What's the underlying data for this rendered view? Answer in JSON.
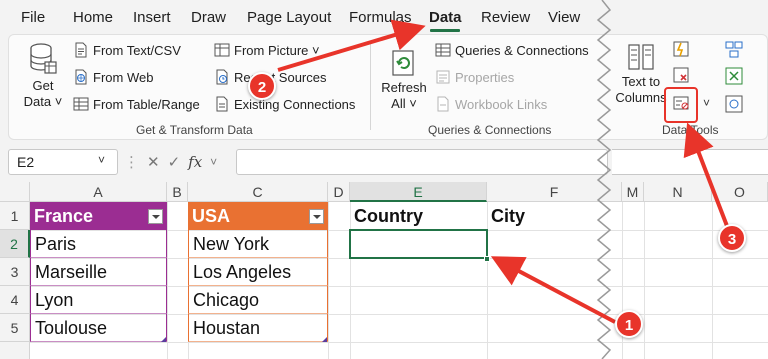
{
  "menu": {
    "tabs": [
      "File",
      "Home",
      "Insert",
      "Draw",
      "Page Layout",
      "Formulas",
      "Data",
      "Review",
      "View"
    ],
    "active": "Data"
  },
  "ribbon": {
    "get_data": {
      "line1": "Get",
      "line2": "Data ˅"
    },
    "from_text_csv": "From Text/CSV",
    "from_web": "From Web",
    "from_table_range": "From Table/Range",
    "from_picture": "From Picture ˅",
    "recent_sources": "Recent Sources",
    "existing_connections": "Existing Connections",
    "group_get_transform": "Get & Transform Data",
    "refresh_all": {
      "line1": "Refresh",
      "line2": "All ˅"
    },
    "queries_connections": "Queries & Connections",
    "properties": "Properties",
    "workbook_links": "Workbook Links",
    "group_queries": "Queries & Connections",
    "text_to_columns": {
      "line1": "Text to",
      "line2": "Columns"
    },
    "group_data_tools": "Data Tools"
  },
  "formula_bar": {
    "name_box": "E2",
    "cancel_symbol": "✕",
    "enter_symbol": "✓",
    "fx_symbol": "fx",
    "formula": ""
  },
  "sheet": {
    "columns": [
      "A",
      "B",
      "C",
      "D",
      "E",
      "F",
      "M",
      "N",
      "O"
    ],
    "rows": [
      "1",
      "2",
      "3",
      "4",
      "5"
    ],
    "selected_cell": "E2",
    "france_table": {
      "header": "France",
      "values": [
        "Paris",
        "Marseille",
        "Lyon",
        "Toulouse"
      ]
    },
    "usa_table": {
      "header": "USA",
      "values": [
        "New York",
        "Los Angeles",
        "Chicago",
        "Houstan"
      ]
    },
    "country_header": "Country",
    "city_header": "City"
  },
  "annotations": [
    "1",
    "2",
    "3"
  ],
  "colors": {
    "accent": "#217346",
    "france_header": "#9b2d92",
    "usa_header": "#e97132",
    "annotation_red": "#e8342a"
  }
}
